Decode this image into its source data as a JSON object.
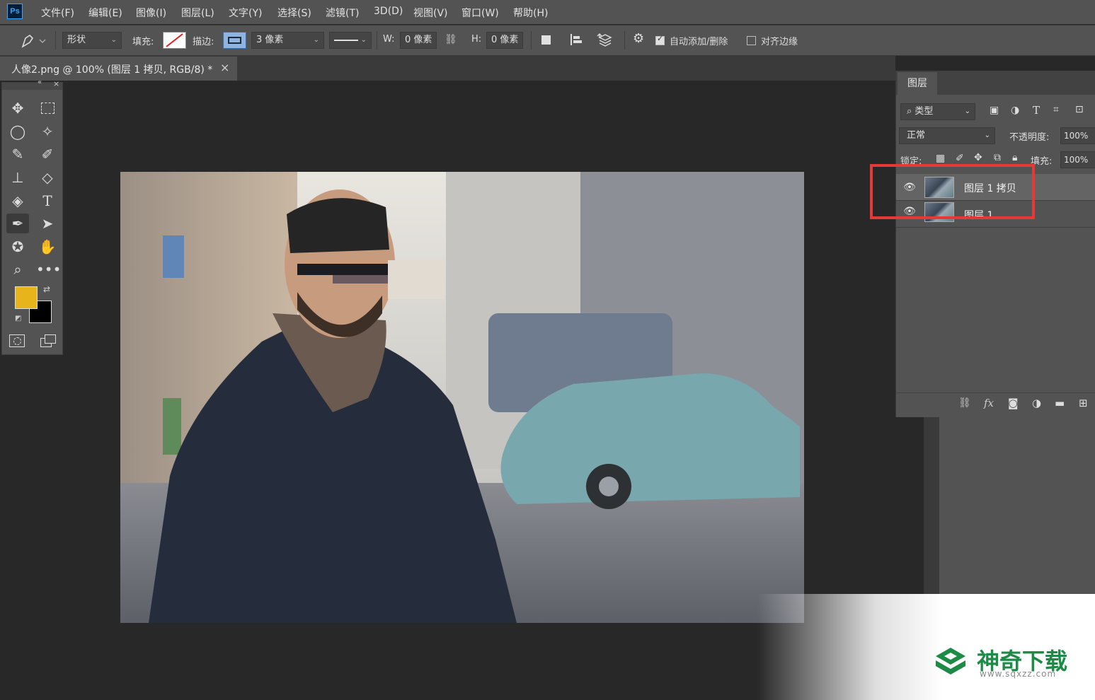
{
  "app": {
    "logo": "Ps"
  },
  "menu": [
    "文件(F)",
    "编辑(E)",
    "图像(I)",
    "图层(L)",
    "文字(Y)",
    "选择(S)",
    "滤镜(T)",
    "3D(D)",
    "视图(V)",
    "窗口(W)",
    "帮助(H)"
  ],
  "options": {
    "mode": "形状",
    "fill_label": "填充:",
    "stroke_label": "描边:",
    "stroke_width": "3 像素",
    "w_label": "W:",
    "w_value": "0 像素",
    "h_label": "H:",
    "h_value": "0 像素",
    "auto_add_delete": "自动添加/删除",
    "auto_add_checked": true,
    "align_edges": "对齐边缘",
    "align_checked": false
  },
  "document": {
    "tab_title": "人像2.png @ 100% (图层 1 拷贝, RGB/8) *",
    "close": "×"
  },
  "toolbox": {
    "foreground_color": "#e8b41c",
    "background_color": "#000000",
    "tools": [
      "move-icon",
      "marquee-icon",
      "lasso-icon",
      "magic-wand-icon",
      "eyedropper-icon",
      "brush-icon",
      "stamp-icon",
      "eraser-icon",
      "paint-bucket-icon",
      "type-icon",
      "pen-icon",
      "path-select-icon",
      "custom-shape-icon",
      "hand-icon",
      "zoom-icon",
      "more-icon"
    ],
    "active_tool": "pen-icon"
  },
  "layers_panel": {
    "tab": "图层",
    "filter": "类型",
    "blend_mode": "正常",
    "opacity_label": "不透明度:",
    "opacity": "100%",
    "lock_label": "锁定:",
    "fill_label": "填充:",
    "fill": "100%",
    "layers": [
      {
        "name": "图层 1 拷贝",
        "visible": true,
        "selected": true
      },
      {
        "name": "图层 1",
        "visible": true,
        "selected": false
      }
    ]
  },
  "watermark": {
    "brand": "神奇下载",
    "url": "www.sqxzz.com"
  }
}
